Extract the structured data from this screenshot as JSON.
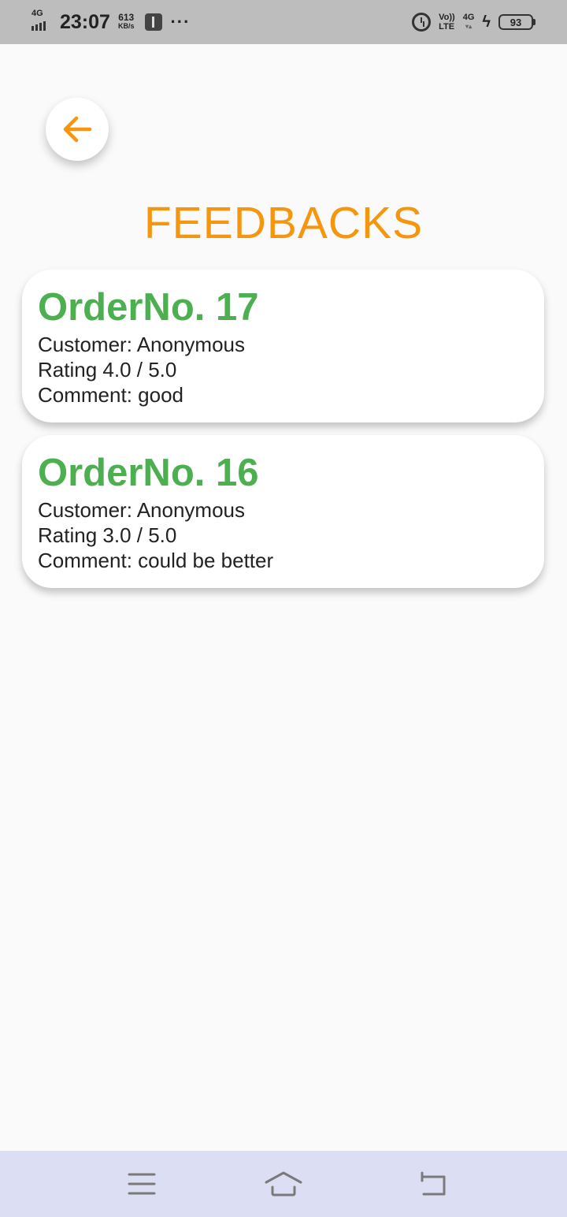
{
  "status_bar": {
    "network_type": "4G",
    "time": "23:07",
    "speed_value": "613",
    "speed_unit": "KB/s",
    "more": "···",
    "volte_top": "Vo))",
    "volte_bottom": "LTE",
    "net_right": "4G",
    "battery": "93"
  },
  "header": {
    "back_icon": "arrow-left-icon",
    "title": "FEEDBACKS",
    "accent_color": "#f5960f"
  },
  "feedbacks": [
    {
      "title": "OrderNo. 17",
      "customer": "Customer: Anonymous",
      "rating": "Rating 4.0 / 5.0",
      "comment": "Comment: good"
    },
    {
      "title": "OrderNo. 16",
      "customer": "Customer: Anonymous",
      "rating": "Rating 3.0 / 5.0",
      "comment": "Comment: could be better"
    }
  ],
  "nav_bar": {
    "menu_icon": "menu-icon",
    "home_icon": "home-icon",
    "back_icon": "back-icon"
  },
  "colors": {
    "order_title": "#4caf50",
    "nav_background": "#dcdff3"
  }
}
